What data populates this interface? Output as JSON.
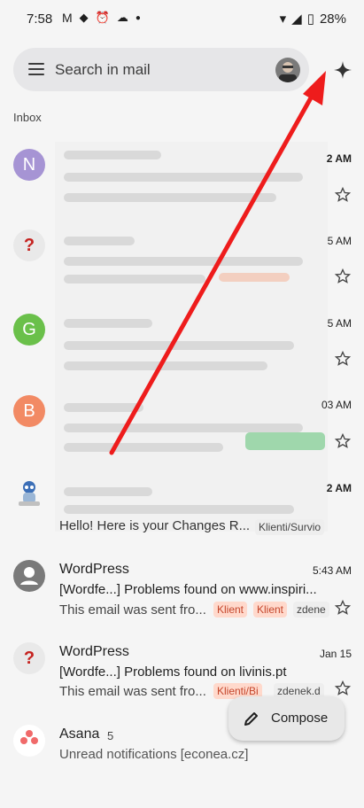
{
  "status": {
    "time": "7:58",
    "battery": "28%"
  },
  "search": {
    "placeholder": "Search in mail"
  },
  "inbox_label": "Inbox",
  "rows": [
    {
      "initial": "N",
      "color": "#a694d4",
      "time": "2 AM"
    },
    {
      "initial": "?",
      "color": "#e9e9e9",
      "time": "5 AM"
    },
    {
      "initial": "G",
      "color": "#6ac04a",
      "time": "5 AM"
    },
    {
      "initial": "B",
      "color": "#f28a64",
      "time": "03 AM"
    },
    {
      "initial": "",
      "color": "#f5f5f5",
      "time": "2 AM",
      "snippet": "Hello! Here is your Changes R...",
      "chip": "Klienti/Survio"
    },
    {
      "sender": "WordPress",
      "time": "5:43 AM",
      "subject": "[Wordfe...] Problems found on www.inspiri...",
      "snippet": "This email was sent fro...",
      "chips": [
        "Klient",
        "Klient",
        "zdene"
      ]
    },
    {
      "sender": "WordPress",
      "time": "Jan 15",
      "subject": "[Wordfe...] Problems found on livinis.pt",
      "snippet": "This email was sent fro...",
      "chips": [
        "Klienti/Bi",
        "zdenek.d"
      ]
    },
    {
      "sender": "Asana",
      "count": "5",
      "subject": "Unread notifications [econea.cz]"
    }
  ],
  "compose": {
    "label": "Compose"
  },
  "colors": {
    "red_arrow": "#ee1c1c",
    "chip_bg": "#ffd9cc"
  }
}
